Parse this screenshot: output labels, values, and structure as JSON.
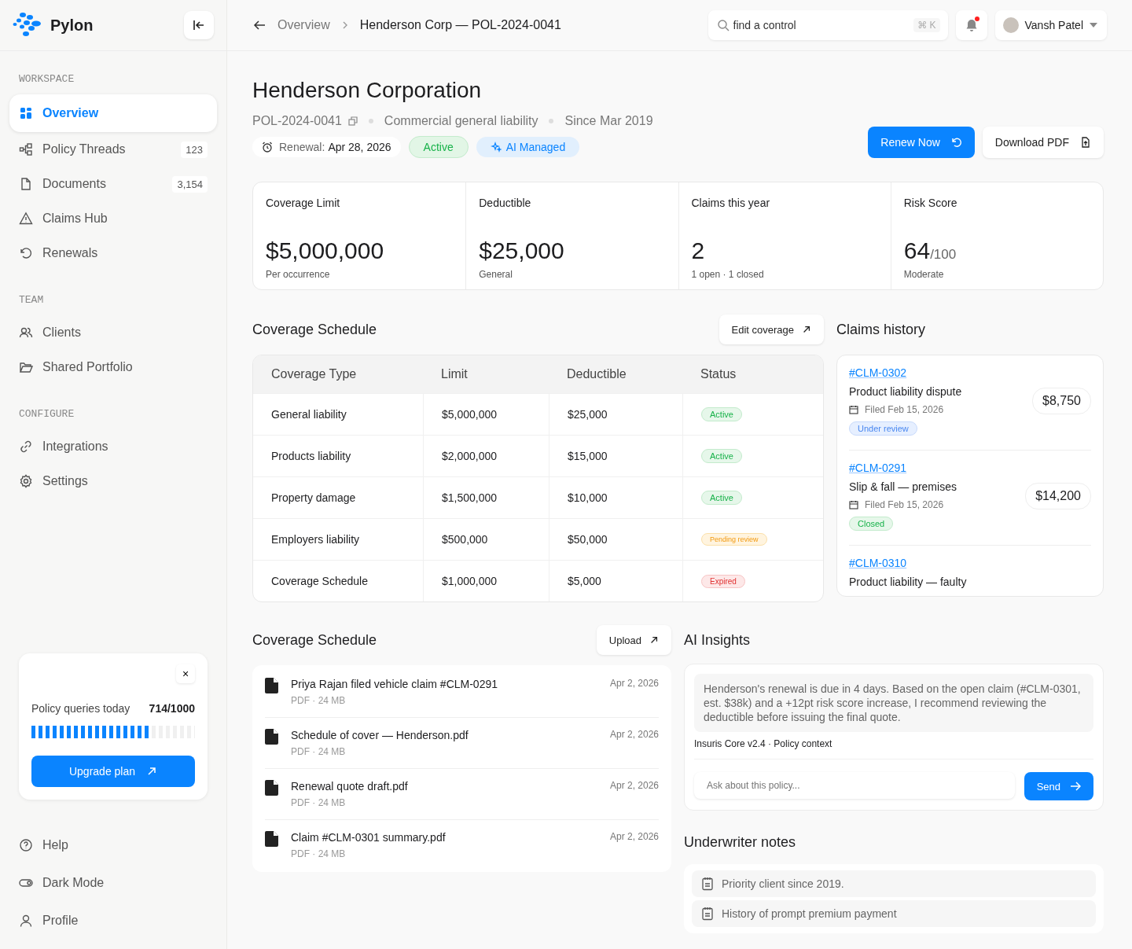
{
  "brand": {
    "name": "Pylon"
  },
  "sidebar": {
    "sections": [
      {
        "title": "WORKSPACE",
        "items": [
          {
            "label": "Overview",
            "selected": true
          },
          {
            "label": "Policy Threads",
            "count": "123",
            "selected": false
          },
          {
            "label": "Documents",
            "count": "3,154",
            "selected": false
          },
          {
            "label": "Claims Hub",
            "selected": false
          },
          {
            "label": "Renewals",
            "selected": false
          }
        ]
      },
      {
        "title": "TEAM",
        "items": [
          {
            "label": "Clients",
            "selected": false
          },
          {
            "label": "Shared Portfolio",
            "selected": false
          }
        ]
      },
      {
        "title": "CONFIGURE",
        "items": [
          {
            "label": "Integrations",
            "selected": false
          },
          {
            "label": "Settings",
            "selected": false
          }
        ]
      }
    ],
    "usage_card": {
      "close": "×",
      "label": "Policy queries today",
      "value": "714/1000",
      "level": 0.714,
      "button": "Upgrade plan"
    },
    "bottom_items": [
      "Help",
      "Dark Mode",
      "Profile"
    ]
  },
  "topbar": {
    "breadcrumb": [
      "Overview",
      "Henderson Corp — POL-2024-0041"
    ],
    "search": {
      "placeholder": "find a control",
      "shortcut": "⌘ K"
    },
    "notifications": {
      "unread": true
    },
    "user": {
      "name": "Vansh Patel"
    }
  },
  "header": {
    "title": "Henderson Corporation",
    "meta": [
      "POL-2024-0041",
      "Commercial general liability",
      "Since Mar 2019"
    ],
    "renewal": {
      "label": "Renewal:",
      "date": "Apr 28, 2026"
    },
    "badges": [
      {
        "label": "Active",
        "kind": "status"
      },
      {
        "label": "AI Managed",
        "kind": "ai"
      }
    ],
    "actions": [
      {
        "label": "Renew Now",
        "kind": "primary"
      },
      {
        "label": "Download PDF",
        "kind": "secondary"
      }
    ]
  },
  "stats": [
    {
      "label": "Coverage Limit",
      "value": "$5,000,000",
      "note": "Per occurrence"
    },
    {
      "label": "Deductible",
      "value": "$25,000",
      "note": "General"
    },
    {
      "label": "Claims this year",
      "value": "2",
      "note": "1 open · 1 closed"
    },
    {
      "label": "Risk Score",
      "value": "64",
      "suffix": "/100",
      "note": "Moderate"
    }
  ],
  "coverage": {
    "title": "Coverage Schedule",
    "action": "Edit coverage",
    "columns": [
      "Coverage Type",
      "Limit",
      "Deductible",
      "Status"
    ],
    "rows": [
      {
        "type": "General liability",
        "limit": "$5,000,000",
        "deductible": "$25,000",
        "status": "Active",
        "kind": "active"
      },
      {
        "type": "Products liability",
        "limit": "$2,000,000",
        "deductible": "$15,000",
        "status": "Active",
        "kind": "active"
      },
      {
        "type": "Property damage",
        "limit": "$1,500,000",
        "deductible": "$10,000",
        "status": "Active",
        "kind": "active"
      },
      {
        "type": "Employers liability",
        "limit": "$500,000",
        "deductible": "$50,000",
        "status": "Pending review",
        "kind": "pending"
      },
      {
        "type": "Coverage Schedule",
        "limit": "$1,000,000",
        "deductible": "$5,000",
        "status": "Expired",
        "kind": "expired"
      }
    ]
  },
  "claims": {
    "title": "Claims history",
    "items": [
      {
        "id": "#CLM-0302",
        "title": "Product liability dispute",
        "filed": "Filed Feb 15, 2026",
        "amount": "$8,750",
        "status": "Under review",
        "kind": "review"
      },
      {
        "id": "#CLM-0291",
        "title": "Slip & fall — premises",
        "filed": "Filed Feb 15, 2026",
        "amount": "$14,200",
        "status": "Closed",
        "kind": "closed"
      },
      {
        "id": "#CLM-0310",
        "title": "Product liability — faulty"
      }
    ]
  },
  "documents": {
    "title": "Coverage Schedule",
    "action": "Upload",
    "items": [
      {
        "name": "Priya Rajan filed vehicle claim #CLM-0291",
        "meta": "PDF · 24 MB",
        "date": "Apr 2, 2026"
      },
      {
        "name": "Schedule of cover — Henderson.pdf",
        "meta": "PDF · 24 MB",
        "date": "Apr 2, 2026"
      },
      {
        "name": "Renewal quote draft.pdf",
        "meta": "PDF · 24 MB",
        "date": "Apr 2, 2026"
      },
      {
        "name": "Claim #CLM-0301 summary.pdf",
        "meta": "PDF · 24 MB",
        "date": "Apr 2, 2026"
      }
    ]
  },
  "ai": {
    "title": "AI Insights",
    "message": "Henderson's renewal is due in 4 days. Based on the open claim (#CLM-0301, est. $38k) and a +12pt risk score increase, I recommend reviewing the deductible before issuing the final quote.",
    "source": "Insuris Core v2.4 · Policy context",
    "input": {
      "placeholder": "Ask about this policy..."
    },
    "send": "Send"
  },
  "notes": {
    "title": "Underwriter notes",
    "items": [
      "Priority client since 2019.",
      "History of prompt premium payment"
    ]
  }
}
